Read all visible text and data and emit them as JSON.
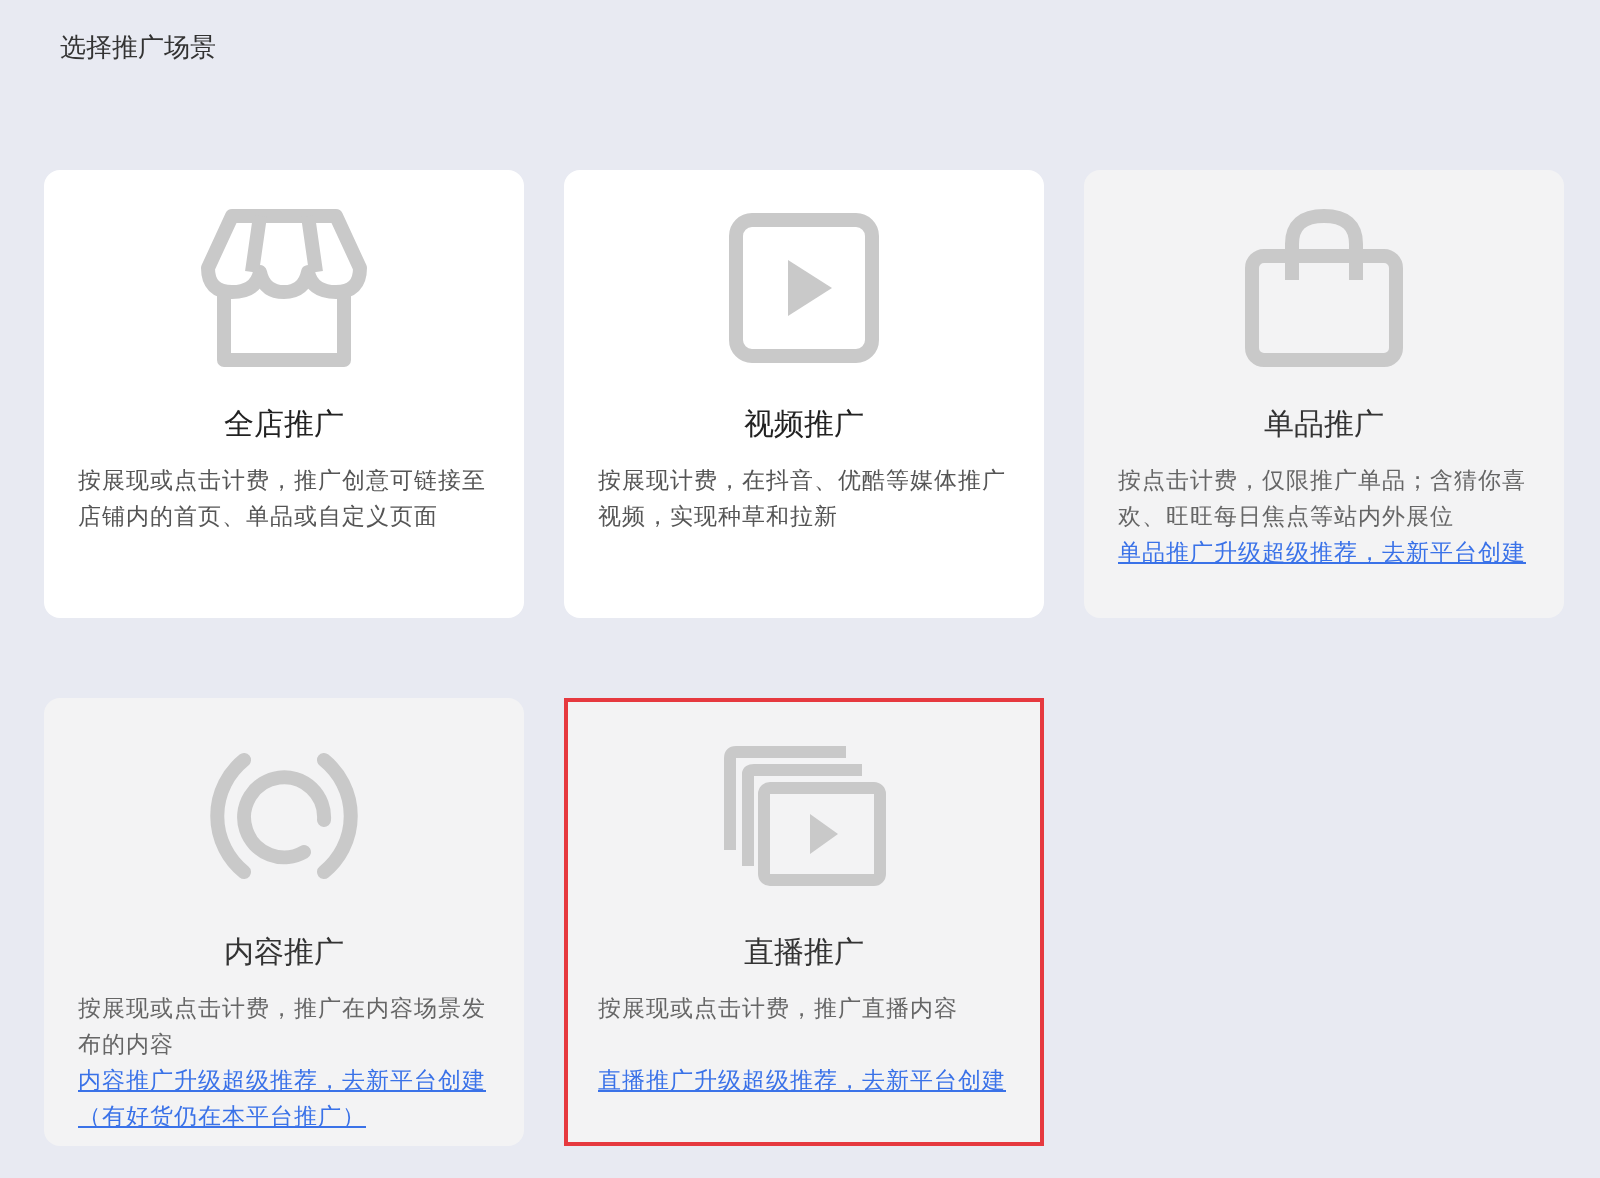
{
  "heading": "选择推广场景",
  "cards": [
    {
      "kind": "store",
      "title": "全店推广",
      "description": "按展现或点击计费，推广创意可链接至店铺内的首页、单品或自定义页面",
      "disabled": false,
      "selected": false
    },
    {
      "kind": "video",
      "title": "视频推广",
      "description": "按展现计费，在抖音、优酷等媒体推广视频，实现种草和拉新",
      "disabled": false,
      "selected": false
    },
    {
      "kind": "bag",
      "title": "单品推广",
      "description": "按点击计费，仅限推广单品；含猜你喜欢、旺旺每日焦点等站内外展位",
      "link": "单品推广升级超级推荐，去新平台创建",
      "disabled": true,
      "selected": false
    },
    {
      "kind": "content",
      "title": "内容推广",
      "description": "按展现或点击计费，推广在内容场景发布的内容",
      "link": "内容推广升级超级推荐，去新平台创建（有好货仍在本平台推广）",
      "disabled": true,
      "selected": false
    },
    {
      "kind": "live",
      "title": "直播推广",
      "description": "按展现或点击计费，推广直播内容",
      "link": "直播推广升级超级推荐，去新平台创建",
      "disabled": true,
      "selected": true
    }
  ]
}
